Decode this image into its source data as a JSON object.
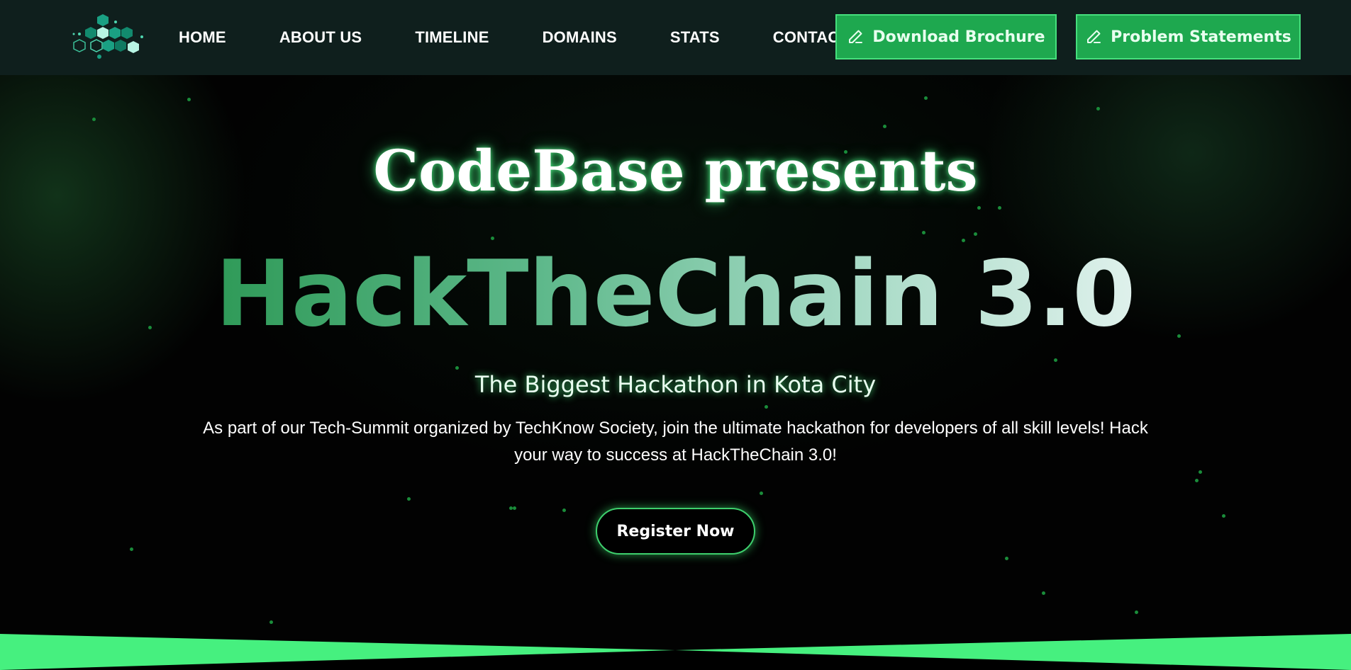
{
  "header": {
    "logo_name": "hexagon-cluster-logo",
    "nav": [
      {
        "label": "HOME"
      },
      {
        "label": "ABOUT US"
      },
      {
        "label": "TIMELINE"
      },
      {
        "label": "DOMAINS"
      },
      {
        "label": "STATS"
      },
      {
        "label": "CONTACT"
      }
    ],
    "buttons": {
      "brochure_label": "Download Brochure",
      "problems_label": "Problem Statements"
    }
  },
  "hero": {
    "presents": "CodeBase presents",
    "title": "HackTheChain 3.0",
    "tagline": "The Biggest Hackathon in Kota City",
    "description": "As part of our Tech-Summit organized by TechKnow Society, join the ultimate hackathon for developers of all skill levels! Hack your way to success at HackTheChain 3.0!",
    "register_label": "Register Now"
  },
  "colors": {
    "nav_bg": "#0f1f1d",
    "accent_green": "#1ea84f",
    "neon_green": "#46f07f",
    "hero_bg": "#020202"
  }
}
